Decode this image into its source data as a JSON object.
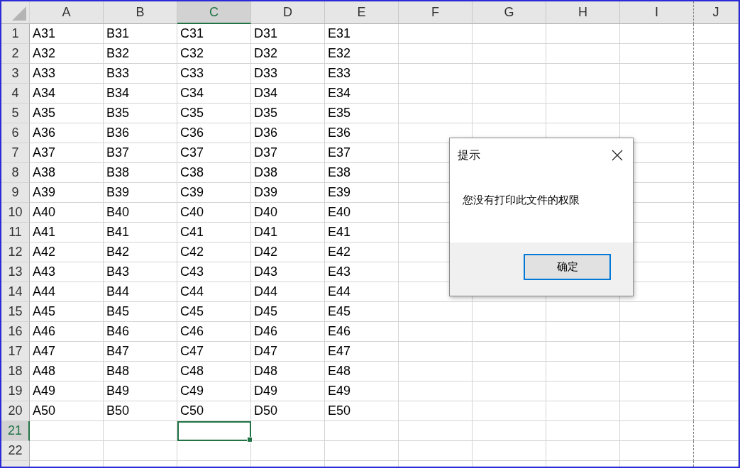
{
  "columns": [
    {
      "label": "A",
      "selected": false,
      "page_break": false
    },
    {
      "label": "B",
      "selected": false,
      "page_break": false
    },
    {
      "label": "C",
      "selected": true,
      "page_break": false
    },
    {
      "label": "D",
      "selected": false,
      "page_break": false
    },
    {
      "label": "E",
      "selected": false,
      "page_break": false
    },
    {
      "label": "F",
      "selected": false,
      "page_break": false
    },
    {
      "label": "G",
      "selected": false,
      "page_break": false
    },
    {
      "label": "H",
      "selected": false,
      "page_break": false
    },
    {
      "label": "I",
      "selected": false,
      "page_break": true
    },
    {
      "label": "J",
      "selected": false,
      "page_break": false
    }
  ],
  "rows": [
    {
      "number": "1",
      "selected": false,
      "cells": [
        "A31",
        "B31",
        "C31",
        "D31",
        "E31"
      ]
    },
    {
      "number": "2",
      "selected": false,
      "cells": [
        "A32",
        "B32",
        "C32",
        "D32",
        "E32"
      ]
    },
    {
      "number": "3",
      "selected": false,
      "cells": [
        "A33",
        "B33",
        "C33",
        "D33",
        "E33"
      ]
    },
    {
      "number": "4",
      "selected": false,
      "cells": [
        "A34",
        "B34",
        "C34",
        "D34",
        "E34"
      ]
    },
    {
      "number": "5",
      "selected": false,
      "cells": [
        "A35",
        "B35",
        "C35",
        "D35",
        "E35"
      ]
    },
    {
      "number": "6",
      "selected": false,
      "cells": [
        "A36",
        "B36",
        "C36",
        "D36",
        "E36"
      ]
    },
    {
      "number": "7",
      "selected": false,
      "cells": [
        "A37",
        "B37",
        "C37",
        "D37",
        "E37"
      ]
    },
    {
      "number": "8",
      "selected": false,
      "cells": [
        "A38",
        "B38",
        "C38",
        "D38",
        "E38"
      ]
    },
    {
      "number": "9",
      "selected": false,
      "cells": [
        "A39",
        "B39",
        "C39",
        "D39",
        "E39"
      ]
    },
    {
      "number": "10",
      "selected": false,
      "cells": [
        "A40",
        "B40",
        "C40",
        "D40",
        "E40"
      ]
    },
    {
      "number": "11",
      "selected": false,
      "cells": [
        "A41",
        "B41",
        "C41",
        "D41",
        "E41"
      ]
    },
    {
      "number": "12",
      "selected": false,
      "cells": [
        "A42",
        "B42",
        "C42",
        "D42",
        "E42"
      ]
    },
    {
      "number": "13",
      "selected": false,
      "cells": [
        "A43",
        "B43",
        "C43",
        "D43",
        "E43"
      ]
    },
    {
      "number": "14",
      "selected": false,
      "cells": [
        "A44",
        "B44",
        "C44",
        "D44",
        "E44"
      ]
    },
    {
      "number": "15",
      "selected": false,
      "cells": [
        "A45",
        "B45",
        "C45",
        "D45",
        "E45"
      ]
    },
    {
      "number": "16",
      "selected": false,
      "cells": [
        "A46",
        "B46",
        "C46",
        "D46",
        "E46"
      ]
    },
    {
      "number": "17",
      "selected": false,
      "cells": [
        "A47",
        "B47",
        "C47",
        "D47",
        "E47"
      ]
    },
    {
      "number": "18",
      "selected": false,
      "cells": [
        "A48",
        "B48",
        "C48",
        "D48",
        "E48"
      ]
    },
    {
      "number": "19",
      "selected": false,
      "cells": [
        "A49",
        "B49",
        "C49",
        "D49",
        "E49"
      ]
    },
    {
      "number": "20",
      "selected": false,
      "cells": [
        "A50",
        "B50",
        "C50",
        "D50",
        "E50"
      ]
    },
    {
      "number": "21",
      "selected": true
    },
    {
      "number": "22",
      "selected": false
    }
  ],
  "dialog": {
    "title": "提示",
    "message": "您没有打印此文件的权限",
    "button": "确定"
  }
}
